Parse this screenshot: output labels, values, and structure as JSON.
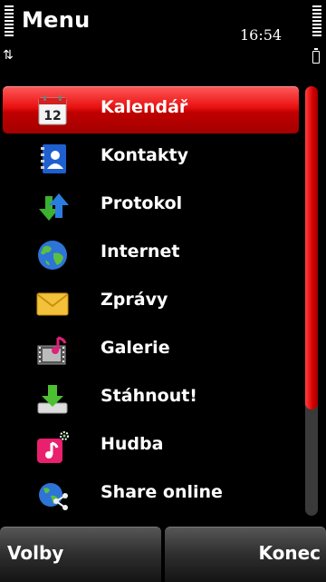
{
  "header": {
    "title": "Menu",
    "time": "16:54",
    "network_icon": "data-transfer-icon"
  },
  "menu": {
    "items": [
      {
        "label": "Kalendář",
        "icon": "calendar-icon",
        "calendar_day": "12",
        "selected": true
      },
      {
        "label": "Kontakty",
        "icon": "contacts-icon"
      },
      {
        "label": "Protokol",
        "icon": "log-icon"
      },
      {
        "label": "Internet",
        "icon": "globe-icon"
      },
      {
        "label": "Zprávy",
        "icon": "envelope-icon"
      },
      {
        "label": "Galerie",
        "icon": "gallery-icon"
      },
      {
        "label": "Stáhnout!",
        "icon": "download-icon"
      },
      {
        "label": "Hudba",
        "icon": "music-icon"
      },
      {
        "label": "Share online",
        "icon": "share-online-icon"
      }
    ]
  },
  "softkeys": {
    "left": "Volby",
    "right": "Konec"
  },
  "colors": {
    "accent": "#e81010",
    "background": "#000000"
  }
}
